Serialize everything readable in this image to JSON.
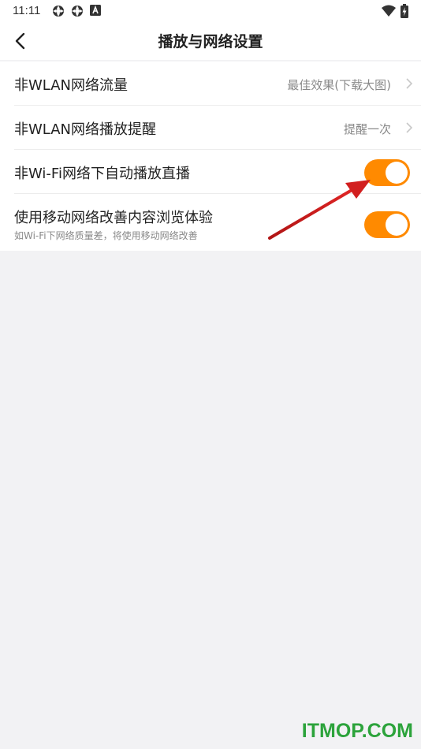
{
  "status_bar": {
    "time": "11:11",
    "left_icons": [
      "sync-icon",
      "sync-icon",
      "font-app-icon"
    ],
    "right_icons": [
      "wifi-icon",
      "battery-charging-icon"
    ]
  },
  "header": {
    "title": "播放与网络设置",
    "back_icon": "back-arrow-icon"
  },
  "settings": {
    "items": [
      {
        "label": "非WLAN网络流量",
        "value": "最佳效果(下载大图)",
        "type": "link"
      },
      {
        "label": "非WLAN网络播放提醒",
        "value": "提醒一次",
        "type": "link"
      },
      {
        "label": "非Wi-Fi网络下自动播放直播",
        "type": "toggle",
        "on": true
      },
      {
        "label": "使用移动网络改善内容浏览体验",
        "sub": "如Wi-Fi下网络质量差，将使用移动网络改善",
        "type": "toggle",
        "on": true
      }
    ]
  },
  "colors": {
    "toggle_on": "#ff8a00",
    "background": "#f2f2f4",
    "annotation_arrow": "#d21f1f",
    "watermark": "#2ca33b"
  },
  "watermark": "ITMOP.COM"
}
